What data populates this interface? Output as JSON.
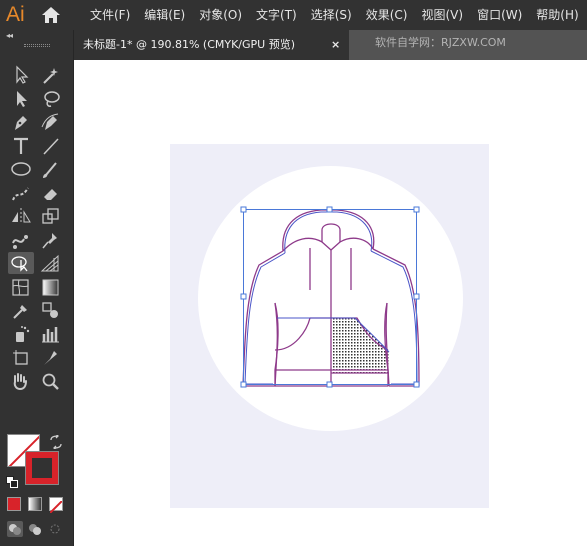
{
  "app": {
    "logo": "Ai"
  },
  "menu": {
    "items": [
      "文件(F)",
      "编辑(E)",
      "对象(O)",
      "文字(T)",
      "选择(S)",
      "效果(C)",
      "视图(V)",
      "窗口(W)",
      "帮助(H)"
    ]
  },
  "document_tab": {
    "label": "未标题-1* @ 190.81% (CMYK/GPU 预览)",
    "close": "×"
  },
  "watermark": "软件自学网：RJZXW.COM",
  "toolbar": {
    "collapse": "◂◂",
    "tools": [
      [
        "selection-tool-icon",
        "magic-wand-tool-icon"
      ],
      [
        "direct-selection-tool-icon",
        "lasso-tool-icon"
      ],
      [
        "pen-tool-icon",
        "curvature-tool-icon"
      ],
      [
        "type-tool-icon",
        "line-tool-icon"
      ],
      [
        "ellipse-tool-icon",
        "paintbrush-tool-icon"
      ],
      [
        "shaper-tool-icon",
        "eraser-tool-icon"
      ],
      [
        "reflect-tool-icon",
        "scale-tool-icon"
      ],
      [
        "puppet-warp-tool-icon",
        "pin-tool-icon"
      ],
      [
        "shape-builder-tool-icon",
        "perspective-grid-tool-icon"
      ],
      [
        "mesh-tool-icon",
        "gradient-tool-icon"
      ],
      [
        "eyedropper-tool-icon",
        "blend-tool-icon"
      ],
      [
        "symbol-sprayer-tool-icon",
        "column-graph-tool-icon"
      ],
      [
        "artboard-tool-icon",
        "slice-tool-icon"
      ],
      [
        "hand-tool-icon",
        "zoom-tool-icon"
      ]
    ],
    "active_tool": "shape-builder-tool-icon",
    "fill_color": "#ffffff",
    "stroke_color": "#d8232a",
    "color_modes": [
      "color",
      "gradient",
      "none"
    ]
  },
  "colors": {
    "artboard": "#eeeef8",
    "hoodie_stroke_outer": "#8e3a8a",
    "hoodie_stroke_inner": "#4a55c8",
    "selection": "#4a78d8"
  }
}
